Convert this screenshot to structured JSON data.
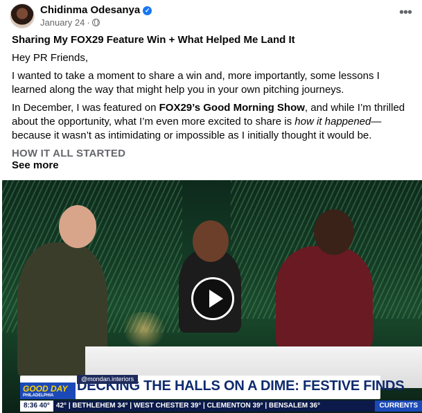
{
  "post": {
    "author": "Chidinma Odesanya",
    "date": "January 24",
    "title": "Sharing My FOX29 Feature Win + What Helped Me Land It",
    "greeting": "Hey PR Friends,",
    "para1": "I wanted to take a moment to share a win and, more importantly, some lessons I learned along the way that might help you in your own pitching journeys.",
    "para2_a": "In December, I was featured on ",
    "para2_bold": "FOX29’s Good Morning Show",
    "para2_b": ", and while I’m thrilled about the opportunity, what I’m even more excited to share is ",
    "para2_italic": "how it happened",
    "para2_c": "—because it wasn’t as intimidating or impossible as I initially thought it would be.",
    "section_heading": "HOW IT ALL STARTED",
    "see_more": "See more"
  },
  "video": {
    "handle": "@mondan.interiors",
    "headline": "DECKING THE HALLS ON A DIME: FESTIVE FINDS",
    "show_name": "GOOD DAY",
    "show_city": "PHILADELPHIA",
    "time": "8:36",
    "temp": "40°",
    "ticker": "42° | BETHLEHEM 34° | WEST CHESTER 39° | CLEMENTON 39° | BENSALEM 36°",
    "currents": "CURRENTS"
  },
  "icons": {
    "verified": "verified-badge-icon",
    "audience": "globe-icon",
    "menu": "more-options-icon",
    "play": "play-icon"
  },
  "colors": {
    "verified_blue": "#1877f2",
    "secondary_text": "#65676b",
    "headline_navy": "#0f2a6e"
  }
}
